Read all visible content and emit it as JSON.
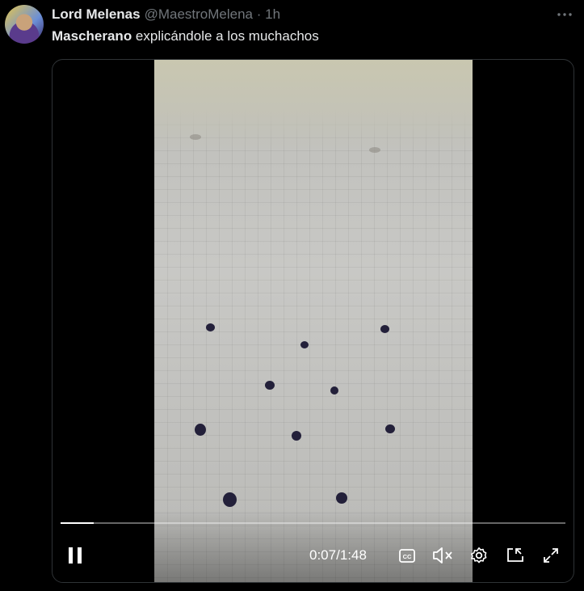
{
  "tweet": {
    "author_name": "Lord Melenas",
    "author_handle": "@MaestroMelena",
    "time_sep": " · ",
    "time": "1h",
    "text_bold": "Mascherano",
    "text_rest": " explicándole a los muchachos"
  },
  "video": {
    "current_time": "0:07",
    "time_separator": " / ",
    "duration": "1:48",
    "progress_fraction": 0.065
  },
  "icons": {
    "more": "more-horizontal-icon",
    "pause": "pause-icon",
    "captions": "closed-captions-icon",
    "mute": "volume-muted-icon",
    "settings": "gear-icon",
    "pip": "picture-in-picture-icon",
    "fullscreen": "expand-icon"
  }
}
